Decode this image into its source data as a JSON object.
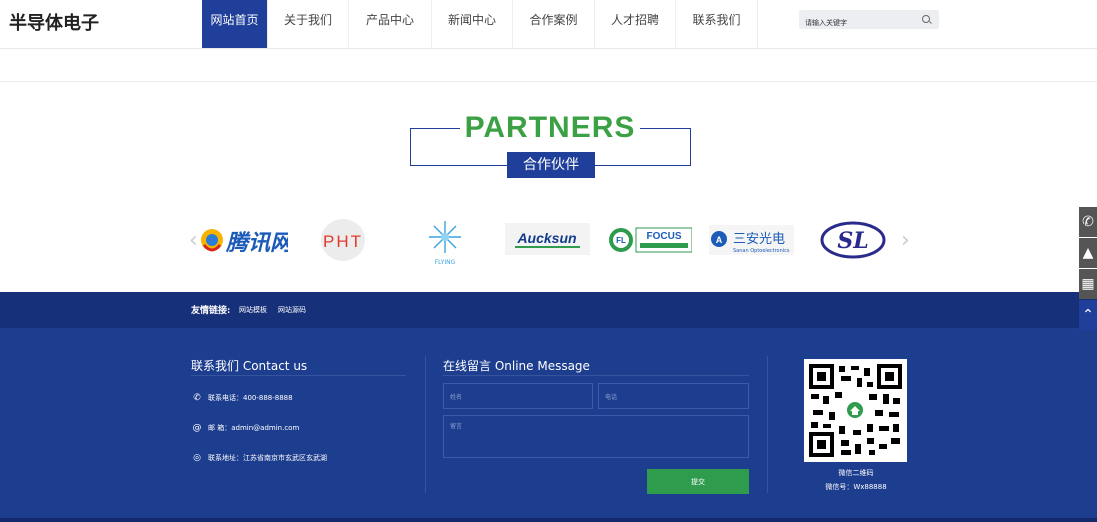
{
  "header": {
    "logo": "半导体电子",
    "nav": [
      "网站首页",
      "关于我们",
      "产品中心",
      "新闻中心",
      "合作案例",
      "人才招聘",
      "联系我们"
    ],
    "active_nav": "网站首页",
    "search_placeholder": "请输入关键字"
  },
  "partners": {
    "title": "PARTNERS",
    "subtitle": "合作伙伴",
    "logos": [
      {
        "name": "tengxun",
        "text": "腾讯网"
      },
      {
        "name": "pht",
        "text": "PHT"
      },
      {
        "name": "flying",
        "text": "FLYING"
      },
      {
        "name": "aucksun",
        "text": "Aucksun"
      },
      {
        "name": "focus",
        "text": "FOCUS"
      },
      {
        "name": "sanan",
        "text": "三安光电",
        "subtext": "Sanan Optoelectronics"
      },
      {
        "name": "sl",
        "text": "SL"
      }
    ]
  },
  "friends": {
    "label": "友情链接:",
    "links": [
      "网站模板",
      "网站源码"
    ]
  },
  "footer": {
    "contact_title": "联系我们 Contact us",
    "phone": "联系电话：400-888-8888",
    "email": "邮 箱：admin@admin.com",
    "address": "联系地址：江苏省南京市玄武区玄武湖",
    "message_title": "在线留言 Online Message",
    "name_placeholder": "姓名",
    "tel_placeholder": "电话",
    "msg_placeholder": "留言",
    "submit": "提交",
    "qr_caption": "微信二维码",
    "wechat": "微信号：Wx88888"
  },
  "colors": {
    "primary": "#1f3f9a",
    "accent_green": "#3ba144",
    "submit_green": "#2e9b4d",
    "footer_bg": "#1d3d8f"
  }
}
